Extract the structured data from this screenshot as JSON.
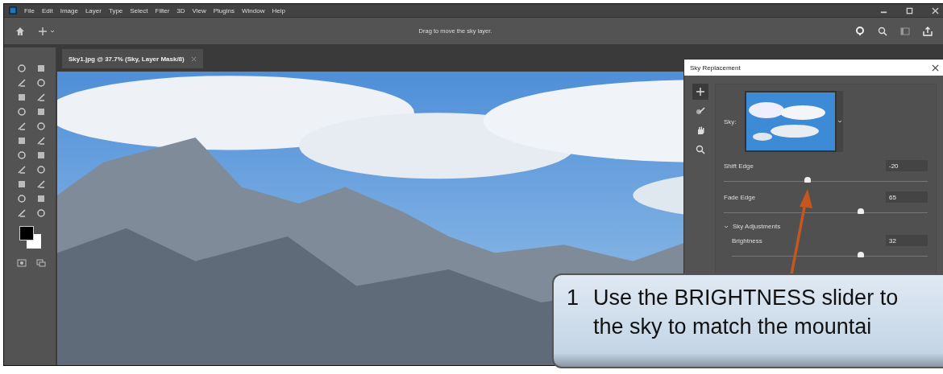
{
  "menu": {
    "items": [
      "File",
      "Edit",
      "Image",
      "Layer",
      "Type",
      "Select",
      "Filter",
      "3D",
      "View",
      "Plugins",
      "Window",
      "Help"
    ]
  },
  "options_bar": {
    "hint": "Drag to move the sky layer."
  },
  "document_tab": {
    "title": "Sky1.jpg @ 37.7% (Sky, Layer Mask/8)"
  },
  "dialog": {
    "title": "Sky Replacement",
    "sky_label": "Sky:",
    "tools": [
      {
        "kind": "move",
        "selected": true
      },
      {
        "kind": "brush",
        "selected": false
      },
      {
        "kind": "hand",
        "selected": false
      },
      {
        "kind": "zoom",
        "selected": false
      }
    ],
    "sliders": [
      {
        "label": "Shift Edge",
        "value": "-20",
        "level": 0.41
      },
      {
        "label": "Fade Edge",
        "value": "65",
        "level": 0.67
      }
    ],
    "section": {
      "title": "Sky Adjustments",
      "expanded": true,
      "sliders": [
        {
          "label": "Brightness",
          "value": "32",
          "level": 0.66
        }
      ]
    }
  },
  "callout": {
    "number": "1",
    "lines": [
      "Use the BRIGHTNESS slider to",
      "the sky to match the mountai"
    ]
  }
}
